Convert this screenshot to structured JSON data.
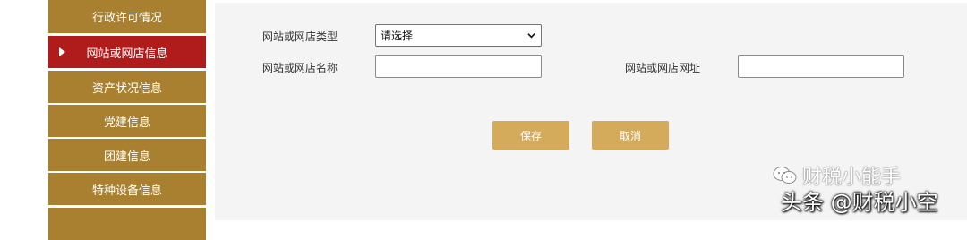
{
  "sidebar": {
    "items": [
      {
        "label": "行政许可情况",
        "active": false
      },
      {
        "label": "网站或网店信息",
        "active": true
      },
      {
        "label": "资产状况信息",
        "active": false
      },
      {
        "label": "党建信息",
        "active": false
      },
      {
        "label": "团建信息",
        "active": false
      },
      {
        "label": "特种设备信息",
        "active": false
      },
      {
        "label": "",
        "active": false
      }
    ],
    "item_color": "#a8802f",
    "active_color": "#b01c1c"
  },
  "form": {
    "type_label": "网站或网店类型",
    "type_select": {
      "value": "请选择"
    },
    "name_label": "网站或网店名称",
    "name_input": {
      "value": ""
    },
    "url_label": "网站或网店网址",
    "url_input": {
      "value": ""
    }
  },
  "buttons": {
    "save": "保存",
    "cancel": "取消",
    "color": "#d4ab5a"
  },
  "watermarks": {
    "wechat": "财税小能手",
    "toutiao": "头条 @财税小空"
  }
}
